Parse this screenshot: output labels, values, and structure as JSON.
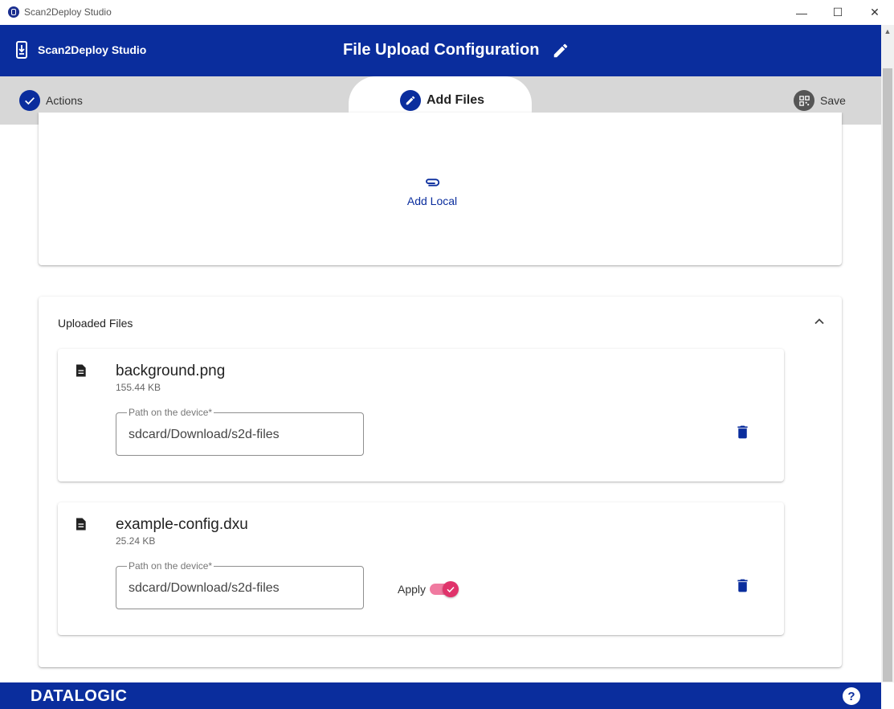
{
  "window": {
    "title": "Scan2Deploy Studio",
    "minimize": "—",
    "maximize": "☐",
    "close": "✕"
  },
  "header": {
    "brand": "Scan2Deploy Studio",
    "title": "File Upload Configuration"
  },
  "tabs": [
    {
      "label": "Actions",
      "state": "completed"
    },
    {
      "label": "Add Files",
      "state": "active"
    },
    {
      "label": "Save",
      "state": "inactive"
    }
  ],
  "add_section": {
    "add_local_label": "Add Local"
  },
  "uploaded": {
    "title": "Uploaded Files",
    "files": [
      {
        "name": "background.png",
        "size": "155.44 KB",
        "path_label": "Path on the device*",
        "path_value": "sdcard/Download/s2d-files"
      },
      {
        "name": "example-config.dxu",
        "size": "25.24 KB",
        "path_label": "Path on the device*",
        "path_value": "sdcard/Download/s2d-files",
        "apply_label": "Apply",
        "apply_checked": true
      }
    ]
  },
  "footer": {
    "logo": "DATALOGIC",
    "help": "?"
  },
  "colors": {
    "primary": "#0a2d9d",
    "tab_bar": "#d7d7d7",
    "toggle": "#e0336b"
  }
}
